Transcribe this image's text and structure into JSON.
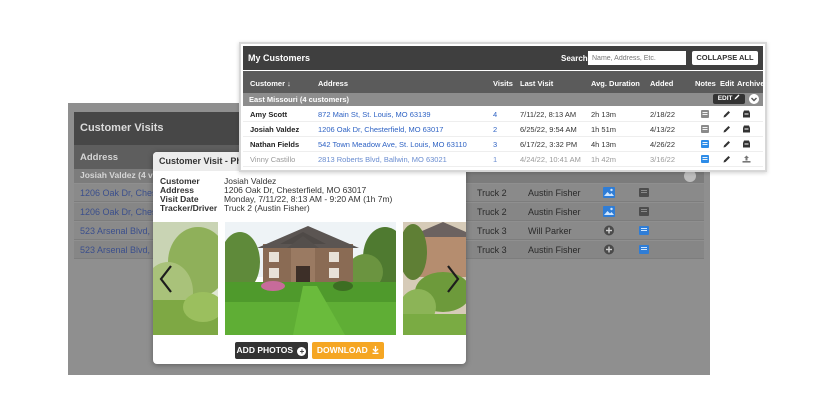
{
  "customer_visits": {
    "title": "Customer Visits",
    "address_header": "Address",
    "group_label": "Josiah Valdez (4 v",
    "rows": [
      {
        "address": "1206 Oak Dr, Chest",
        "truck": "Truck 2",
        "driver": "Austin Fisher",
        "media": "photo-icon"
      },
      {
        "address": "1206 Oak Dr, Chest",
        "truck": "Truck 2",
        "driver": "Austin Fisher",
        "media": "photo-icon"
      },
      {
        "address": "523 Arsenal Blvd, S",
        "truck": "Truck 3",
        "driver": "Will Parker",
        "media": "add-circle-icon"
      },
      {
        "address": "523 Arsenal Blvd, S",
        "truck": "Truck 3",
        "driver": "Austin Fisher",
        "media": "add-circle-icon"
      }
    ]
  },
  "visit_modal": {
    "title": "Customer Visit - Ph",
    "customer_label": "Customer",
    "customer_value": "Josiah Valdez",
    "address_label": "Address",
    "address_value": "1206 Oak Dr, Chesterfield, MO 63017",
    "date_label": "Visit Date",
    "date_value": "Monday, 7/11/22, 8:13 AM - 9:20 AM (1h 7m)",
    "tracker_label": "Tracker/Driver",
    "tracker_value": "Truck 2 (Austin Fisher)",
    "add_photos_label": "ADD PHOTOS",
    "download_label": "DOWNLOAD"
  },
  "my_customers": {
    "title": "My Customers",
    "search_label": "Search",
    "search_placeholder": "Name, Address, Etc.",
    "collapse_label": "COLLAPSE ALL",
    "columns": {
      "customer": "Customer ↓",
      "address": "Address",
      "visits": "Visits",
      "last_visit": "Last Visit",
      "avg_duration": "Avg. Duration",
      "added": "Added",
      "notes": "Notes",
      "edit": "Edit",
      "archive": "Archive"
    },
    "group_label": "East Missouri (4 customers)",
    "edit_label": "EDIT",
    "rows": [
      {
        "name": "Amy Scott",
        "address": "872 Main St, St. Louis, MO 63139",
        "visits": "4",
        "last_visit": "7/11/22, 8:13 AM",
        "avg": "2h 13m",
        "added": "2/18/22",
        "note_color": "#8a8a8a",
        "archive": "inbox-icon"
      },
      {
        "name": "Josiah Valdez",
        "address": "1206 Oak Dr, Chesterfield, MO 63017",
        "visits": "2",
        "last_visit": "6/25/22, 9:54 AM",
        "avg": "1h 51m",
        "added": "4/13/22",
        "note_color": "#8a8a8a",
        "archive": "inbox-icon"
      },
      {
        "name": "Nathan Fields",
        "address": "542 Town Meadow Ave, St. Louis, MO 63110",
        "visits": "3",
        "last_visit": "6/17/22, 3:32 PM",
        "avg": "4h 13m",
        "added": "4/26/22",
        "note_color": "#2d8ce8",
        "archive": "inbox-icon"
      },
      {
        "name": "Vinny Castillo",
        "address": "2813 Roberts Blvd, Ballwin, MO 63021",
        "visits": "1",
        "last_visit": "4/24/22, 10:41 AM",
        "avg": "1h 42m",
        "added": "3/16/22",
        "note_color": "#2d8ce8",
        "archive": "unarchive-icon"
      }
    ]
  }
}
